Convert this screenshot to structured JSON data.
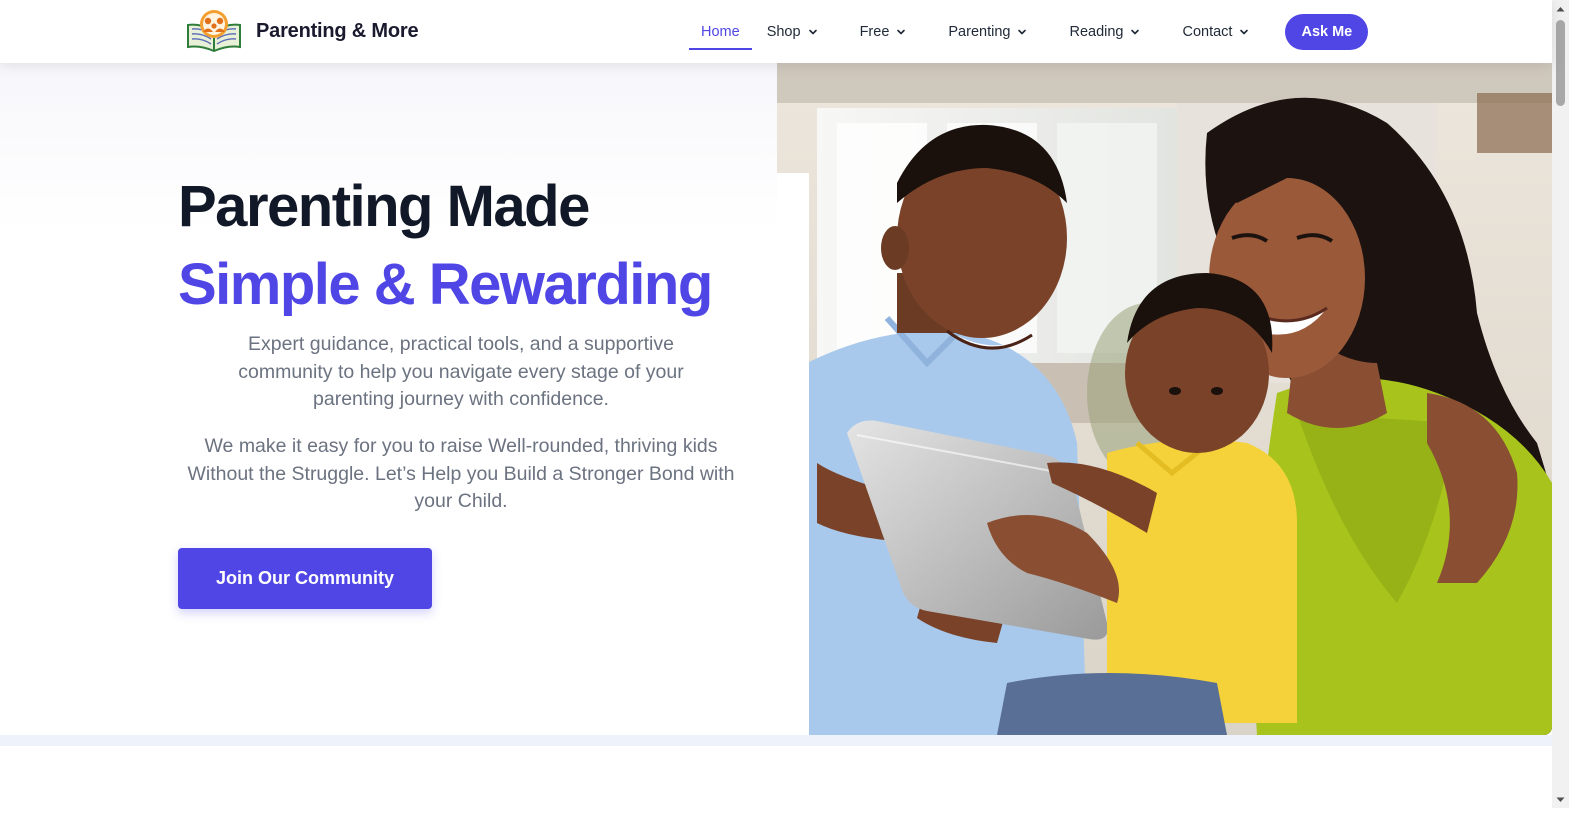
{
  "brand": {
    "name": "Parenting & More",
    "logo_icon": "open-book-family-logo"
  },
  "nav": {
    "items": [
      {
        "label": "Home",
        "active": true,
        "has_dropdown": false
      },
      {
        "label": "Shop",
        "active": false,
        "has_dropdown": true
      },
      {
        "label": "Free",
        "active": false,
        "has_dropdown": true
      },
      {
        "label": "Parenting",
        "active": false,
        "has_dropdown": true
      },
      {
        "label": "Reading",
        "active": false,
        "has_dropdown": true
      },
      {
        "label": "Contact",
        "active": false,
        "has_dropdown": true
      }
    ],
    "cta_label": "Ask Me",
    "dropdown_icon": "chevron-down-icon"
  },
  "hero": {
    "headline_line1": "Parenting Made",
    "headline_line2": "Simple & Rewarding",
    "subtext1": "Expert guidance, practical tools, and a supportive community to help you navigate every stage of your parenting journey with confidence.",
    "subtext2": "We make it easy for you to raise Well-rounded, thriving kids Without the Struggle. Let’s Help you Build a Stronger Bond with your Child.",
    "cta_label": "Join Our Community",
    "image_subject": "mother-and-two-sons-with-tablet-photo"
  },
  "colors": {
    "accent": "#4f46e5",
    "heading": "#111827",
    "body_text": "#6b7280",
    "band": "#eef3fb"
  }
}
